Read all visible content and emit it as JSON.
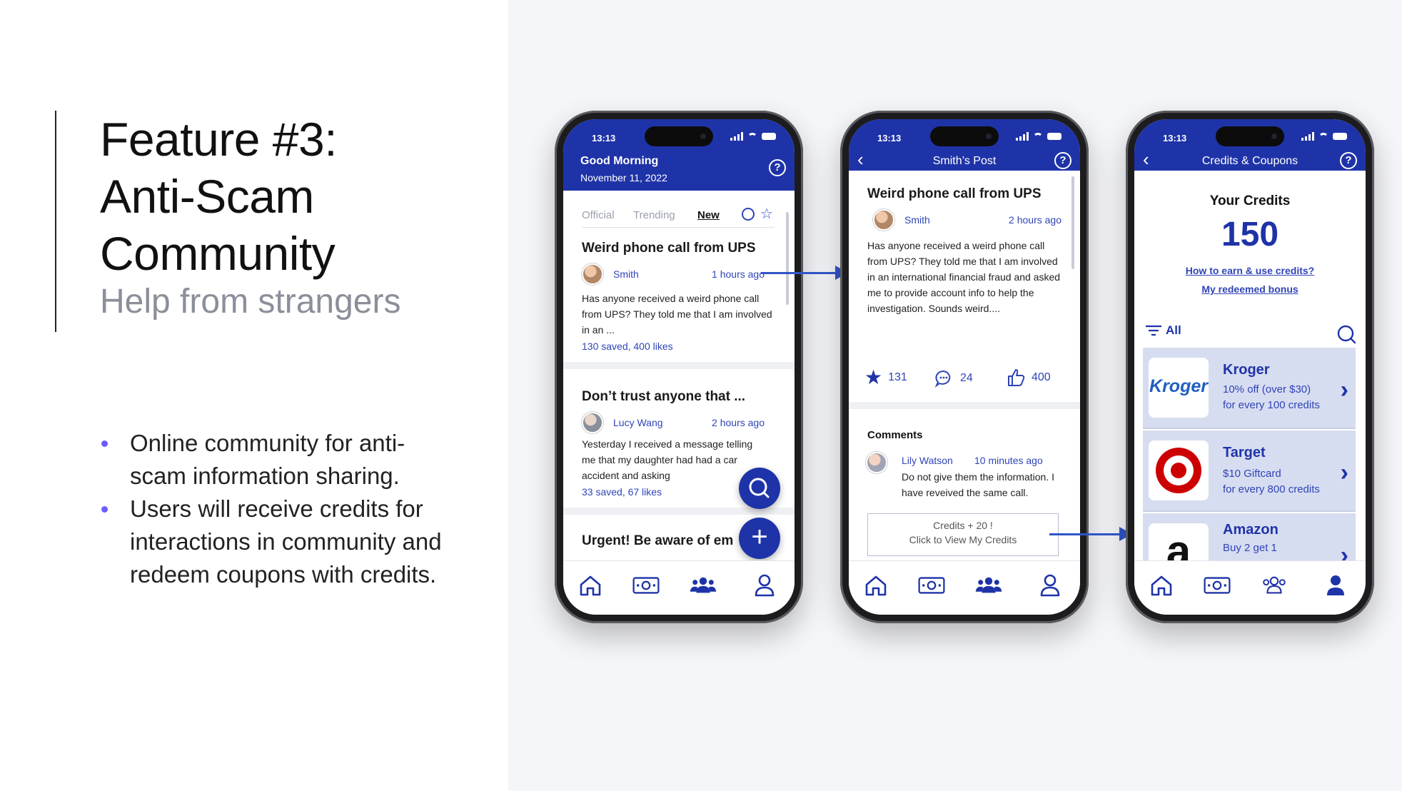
{
  "slide": {
    "title_line1": "Feature #3:",
    "title_line2": "Anti-Scam",
    "title_line3": "Community",
    "subtitle": "Help from strangers",
    "bullets": [
      "Online community for anti-scam information sharing.",
      "Users will receive credits for interactions in community and redeem coupons with credits."
    ]
  },
  "colors": {
    "brand": "#1f33a8",
    "link": "#2f44b7",
    "accent_bullet": "#6b5cff"
  },
  "status_time": "13:13",
  "phone1": {
    "greeting": "Good Morning",
    "date": "November 11, 2022",
    "filters": [
      "Official",
      "Trending",
      "New"
    ],
    "posts": [
      {
        "title": "Weird phone call from UPS",
        "author": "Smith",
        "ago": "1 hours ago",
        "text": "Has anyone received a weird phone call from UPS? They told me that I am involved in an ...",
        "meta": "130 saved, 400 likes"
      },
      {
        "title": "Don’t trust anyone that ...",
        "author": "Lucy Wang",
        "ago": "2 hours ago",
        "text": "Yesterday I received a message telling me that my daughter had had a car accident and asking",
        "meta": "33 saved, 67 likes"
      },
      {
        "title": "Urgent! Be aware of em"
      }
    ]
  },
  "phone2": {
    "header_title": "Smith’s Post",
    "post_title": "Weird phone call from UPS",
    "author": "Smith",
    "ago": "2 hours ago",
    "text": "Has anyone received a weird phone call from UPS? They told me that I am involved in an international financial fraud and asked me to provide account info to help the investigation. Sounds weird....",
    "stars": "131",
    "comments_count": "24",
    "likes": "400",
    "comments_heading": "Comments",
    "comment": {
      "author": "Lily Watson",
      "ago": "10 minutes ago",
      "text": "Do not give them the information. I have reveived the same call."
    },
    "toast_line1": "Credits + 20 !",
    "toast_line2": "Click to View My Credits"
  },
  "phone3": {
    "header_title": "Credits & Coupons",
    "credits_label": "Your Credits",
    "credits_value": "150",
    "link1": "How to earn & use credits?",
    "link2": "My redeemed bonus",
    "filter_label": "All",
    "coupons": [
      {
        "name": "Kroger",
        "line1": "10% off (over $30)",
        "line2": "for every 100 credits",
        "logo_text": "Kroger"
      },
      {
        "name": "Target",
        "line1": "$10 Giftcard",
        "line2": "for every 800 credits"
      },
      {
        "name": "Amazon",
        "line1": "Buy 2 get 1",
        "logo_text": "a"
      }
    ]
  },
  "tabs": [
    "home-icon",
    "wallet-icon",
    "community-icon",
    "profile-icon"
  ]
}
